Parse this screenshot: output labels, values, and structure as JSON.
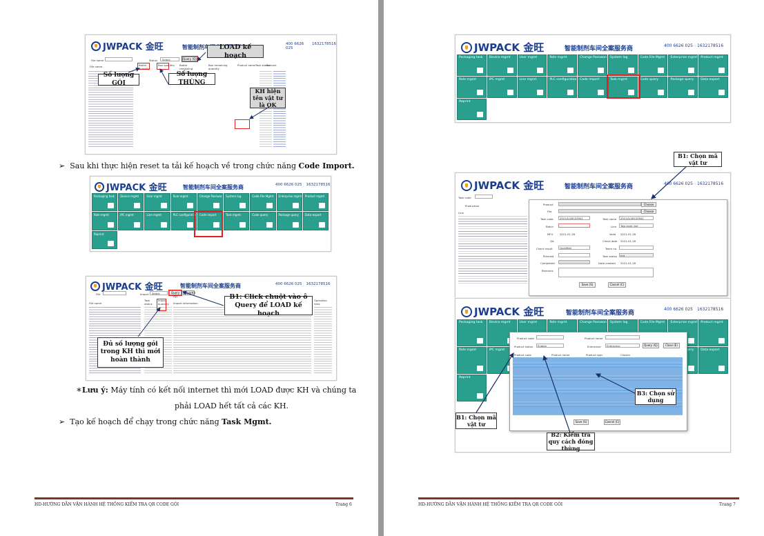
{
  "brand": {
    "logo": "JWPACK 金旺",
    "slogan": "智能制剂车间全案服务商",
    "phone1": "400 6626 025",
    "phone2": "1632178516"
  },
  "tiles_row1": [
    "Packaging task",
    "Device mgmt",
    "User mgmt",
    "Role mgmt",
    "Change Password",
    "System log",
    "Code File Mgmt",
    "Enterprise mgmt",
    "Product mgmt"
  ],
  "tiles_row2": [
    "Role mgmt",
    "IPC mgmt",
    "Line mgmt",
    "PLC configuration",
    "Code import",
    "Task mgmt",
    "Code query",
    "Package query",
    "Data export"
  ],
  "tiles_row3": [
    "Reprint"
  ],
  "page6": {
    "shot1": {
      "filter_label": "File name",
      "status_label": "Status",
      "status_value": "Select",
      "query_btn": "Query (Q)",
      "columns": [
        "File name",
        "Bottle quantity",
        "Box quantity",
        "Bottle remaining quantity",
        "Box remaining quantity",
        "Product name",
        "Task status",
        "Remark"
      ],
      "callout_load": "LOAD kế hoạch",
      "callout_goi": "Số lượng GÓI",
      "callout_thung": "Số lượng THÙNG",
      "callout_kh": "KH hiện tên vật tư là OK"
    },
    "bullet1_pre": "Sau khi thực hiện reset ta tải kế hoạch về trong chức năng ",
    "bullet1_bold": "Code Import.",
    "shot3": {
      "file_label": "File",
      "import_label": "Import",
      "select": "Select",
      "query_btn": "Query (Q)",
      "import_btn": "Import(I)",
      "columns": [
        "File name",
        "Task status",
        "Import quantity",
        "Import information",
        "Operation time"
      ],
      "callout_b1": "B1: Click chuột vào ô Query để LOAD kế hoạch",
      "callout_du": "Đủ số lượng gói trong KH thì mới hoàn thành"
    },
    "note_mark": "∗",
    "note_bold": "Lưu ý:",
    "note_line1": " Máy tính có kết nối internet thì mới LOAD được KH và chúng ta",
    "note_line2": "phải LOAD hết tất cả các KH.",
    "bullet2_pre": "Tạo kế hoạch để chạy trong chức năng ",
    "bullet2_bold": "Task Mgmt.",
    "footer_left": "HD-HƯỚNG DẪN VẬN HÀNH HỆ THỐNG KIỂM TRA QR CODE GÓI",
    "footer_right": "Trang 6"
  },
  "page7": {
    "callout_b1_ma": "B1: Chọn mã vật tư",
    "shot2": {
      "labels_left": [
        "Task code",
        "Production",
        "Line"
      ],
      "form_labels": [
        "Product",
        "File",
        "Task code",
        "Batch",
        "MFG",
        "QA",
        "Check result",
        "Planned",
        "Completed",
        "Remarks",
        "Task name",
        "Line",
        "Valid",
        "Check date",
        "Team no.",
        "Task status",
        "Date created"
      ],
      "task_code_value": "20210128153941",
      "task_name_value": "20210128153941",
      "line_value": "Two level line",
      "mfg_value": "2021-01-28",
      "valid_value": "2021-01-28",
      "check_date_value": "2021-01-28",
      "check_result_value": "Qualified",
      "date_created_value": "2021-01-28",
      "task_status_value": "Init",
      "choose_btn": "Choose",
      "choose2_btn": "Choose",
      "save_btn": "Save (S)",
      "cancel_btn": "Cancel (C)"
    },
    "shot3": {
      "product_code": "Product code",
      "product_name": "Product name",
      "product_status": "Product status",
      "status_value": "Enable",
      "enterprise": "Enterprise",
      "enterprise_value": "Enterprise",
      "query_btn": "Query (Q)",
      "close_btn": "Close (E)",
      "columns": [
        "Product code",
        "Product name",
        "Product spec",
        "Chosen"
      ],
      "callout_b1": "B1: Chọn mã vật tư",
      "callout_b2": "B2: Kiểm tra quy cách đóng thùng",
      "callout_b3": "B3: Chọn sử dụng",
      "save_btn": "Save (S)",
      "cancel_btn": "Cancel (C)"
    },
    "footer_left": "HD-HƯỚNG DẪN VẬN HÀNH HỆ THỐNG KIỂM TRA QR CODE GÓI",
    "footer_right": "Trang 7"
  }
}
